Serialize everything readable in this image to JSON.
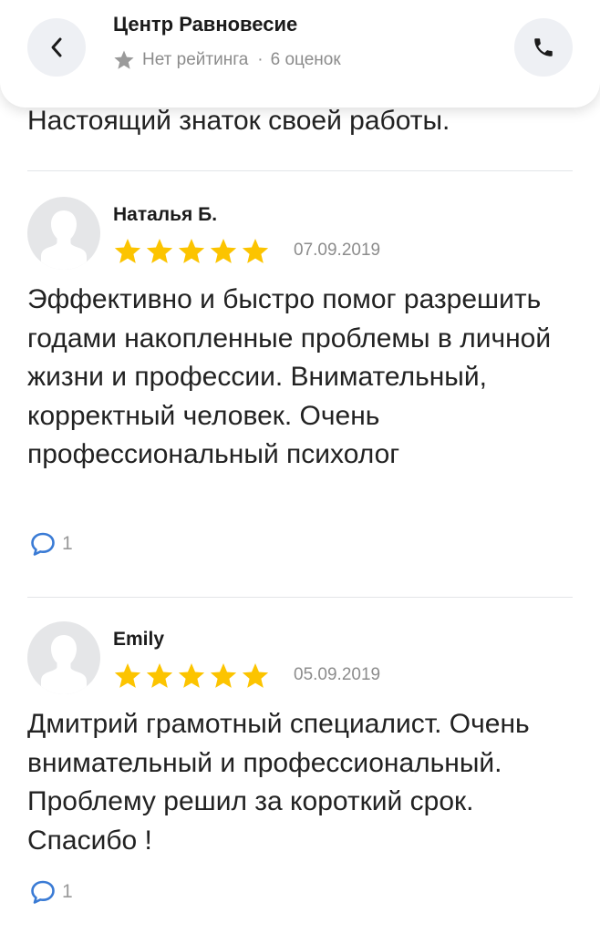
{
  "header": {
    "back_icon": "chevron-left-icon",
    "title": "Центр Равновесие",
    "rating_icon": "star-icon",
    "rating_text": "Нет рейтинга",
    "separator": "·",
    "count_text": "6 оценок",
    "phone_icon": "phone-icon"
  },
  "previous_review_tail": "Настоящий знаток своей работы.",
  "reviews": [
    {
      "author": "Наталья Б.",
      "stars": 5,
      "date": "07.09.2019",
      "text": "Эффективно и быстро помог разрешить годами накопленные проблемы в личной жизни и профессии. Внимательный, корректный человек. Очень профессиональный психолог",
      "comments": "1"
    },
    {
      "author": "Emily",
      "stars": 5,
      "date": "05.09.2019",
      "text": "Дмитрий грамотный специалист. Очень внимательный и профессиональный. Проблему решил за короткий срок. Спасибо !",
      "comments": "1"
    }
  ],
  "colors": {
    "star": "#fcc400",
    "muted": "#8c8c8c",
    "button_bg": "#eef0f4"
  }
}
